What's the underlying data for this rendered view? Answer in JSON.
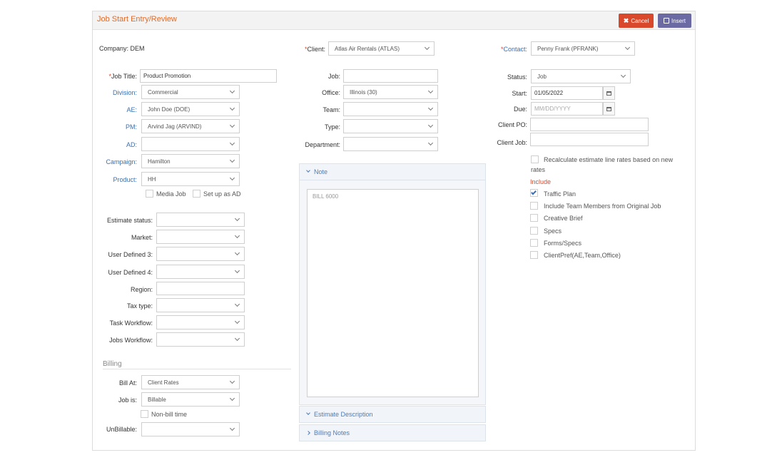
{
  "header": {
    "title": "Job Start Entry/Review",
    "cancel_label": "Cancel",
    "insert_label": "Insert"
  },
  "company": {
    "label": "Company:",
    "value": "DEM"
  },
  "left": {
    "job_title": {
      "label": "Job Title:",
      "value": "Product Promotion"
    },
    "division": {
      "label": "Division:",
      "value": "Commercial"
    },
    "ae": {
      "label": "AE:",
      "value": "John Doe (DOE)"
    },
    "pm": {
      "label": "PM:",
      "value": "Arvind Jag (ARVIND)"
    },
    "ad": {
      "label": "AD:",
      "value": ""
    },
    "campaign": {
      "label": "Campaign:",
      "value": "Hamilton"
    },
    "product": {
      "label": "Product:",
      "value": "HH"
    },
    "media_job": "Media Job",
    "set_up_as_ad": "Set up as AD",
    "estimate_status": {
      "label": "Estimate status:",
      "value": ""
    },
    "market": {
      "label": "Market:",
      "value": ""
    },
    "user_defined_3": {
      "label": "User Defined 3:",
      "value": ""
    },
    "user_defined_4": {
      "label": "User Defined 4:",
      "value": ""
    },
    "region": {
      "label": "Region:",
      "value": ""
    },
    "tax_type": {
      "label": "Tax type:",
      "value": ""
    },
    "task_workflow": {
      "label": "Task Workflow:",
      "value": ""
    },
    "jobs_workflow": {
      "label": "Jobs Workflow:",
      "value": ""
    },
    "billing_heading": "Billing",
    "bill_at": {
      "label": "Bill At:",
      "value": "Client Rates"
    },
    "job_is": {
      "label": "Job is:",
      "value": "Billable"
    },
    "non_bill_time": "Non-bill time",
    "unbillable": {
      "label": "UnBillable:",
      "value": ""
    }
  },
  "middle": {
    "client": {
      "label": "Client:",
      "value": "Atlas Air Rentals (ATLAS)"
    },
    "job": {
      "label": "Job:",
      "value": ""
    },
    "office": {
      "label": "Office:",
      "value": "Illinois (30)"
    },
    "team": {
      "label": "Team:",
      "value": ""
    },
    "type": {
      "label": "Type:",
      "value": ""
    },
    "department": {
      "label": "Department:",
      "value": ""
    },
    "note_header": "Note",
    "note_text": "BILL 6000",
    "estimate_description": "Estimate Description",
    "billing_notes": "Billing Notes"
  },
  "right": {
    "contact": {
      "label": "Contact:",
      "value": "Penny Frank (PFRANK)"
    },
    "status": {
      "label": "Status:",
      "value": "Job"
    },
    "start": {
      "label": "Start:",
      "value": "01/05/2022"
    },
    "due": {
      "label": "Due:",
      "placeholder": "MM/DD/YYYY"
    },
    "client_po": {
      "label": "Client PO:",
      "value": ""
    },
    "client_job": {
      "label": "Client Job:",
      "value": ""
    },
    "recalculate_line1": "Recalculate estimate line rates based on new",
    "recalculate_line2": "rates",
    "include_heading": "Include",
    "include_items": [
      {
        "label": "Traffic Plan",
        "checked": true
      },
      {
        "label": "Include Team Members from Original Job",
        "checked": false
      },
      {
        "label": "Creative Brief",
        "checked": false
      },
      {
        "label": "Specs",
        "checked": false
      },
      {
        "label": "Forms/Specs",
        "checked": false
      },
      {
        "label": "ClientPref(AE,Team,Office)",
        "checked": false
      }
    ]
  },
  "colors": {
    "accent": "#e06b2a",
    "cancel": "#d9482b",
    "insert": "#6b6aa2",
    "link_blue": "#3a6fb3"
  }
}
